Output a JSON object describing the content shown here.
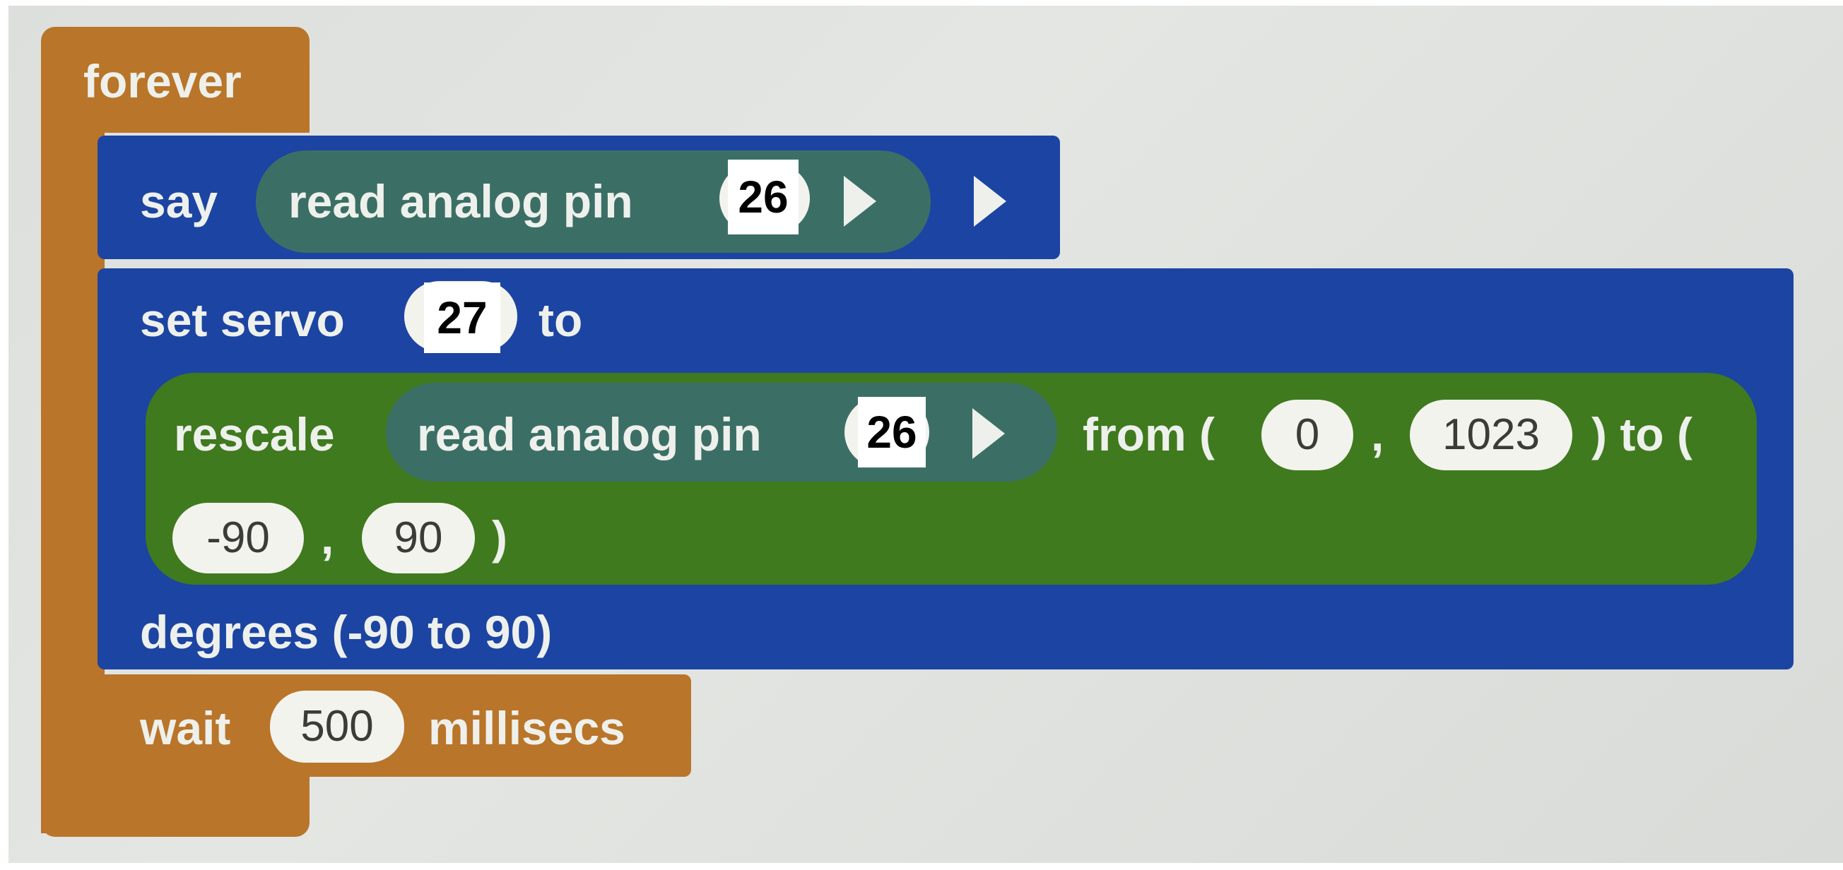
{
  "blocks": {
    "forever": {
      "label": "forever"
    },
    "say": {
      "label": "say",
      "reporter": {
        "label": "read analog pin",
        "pin": "26"
      }
    },
    "servo": {
      "label_pre": "set servo",
      "servo_id": "27",
      "label_to": "to",
      "rescale": {
        "label": "rescale",
        "reporter": {
          "label": "read analog pin",
          "pin": "26"
        },
        "from_label": "from (",
        "from_min": "0",
        "comma_1": ",",
        "from_max": "1023",
        "to_label": ") to (",
        "to_min": "-90",
        "comma_2": ",",
        "to_max": "90",
        "close_paren": ")"
      },
      "footer": "degrees (-90 to 90)"
    },
    "wait": {
      "label_pre": "wait",
      "value": "500",
      "label_post": "millisecs"
    }
  },
  "colors": {
    "control": "#b9752a",
    "pins": "#1c44a2",
    "operator": "#3f7a1e",
    "reporter": "#3b6f66",
    "background": "#dcdfdc"
  }
}
